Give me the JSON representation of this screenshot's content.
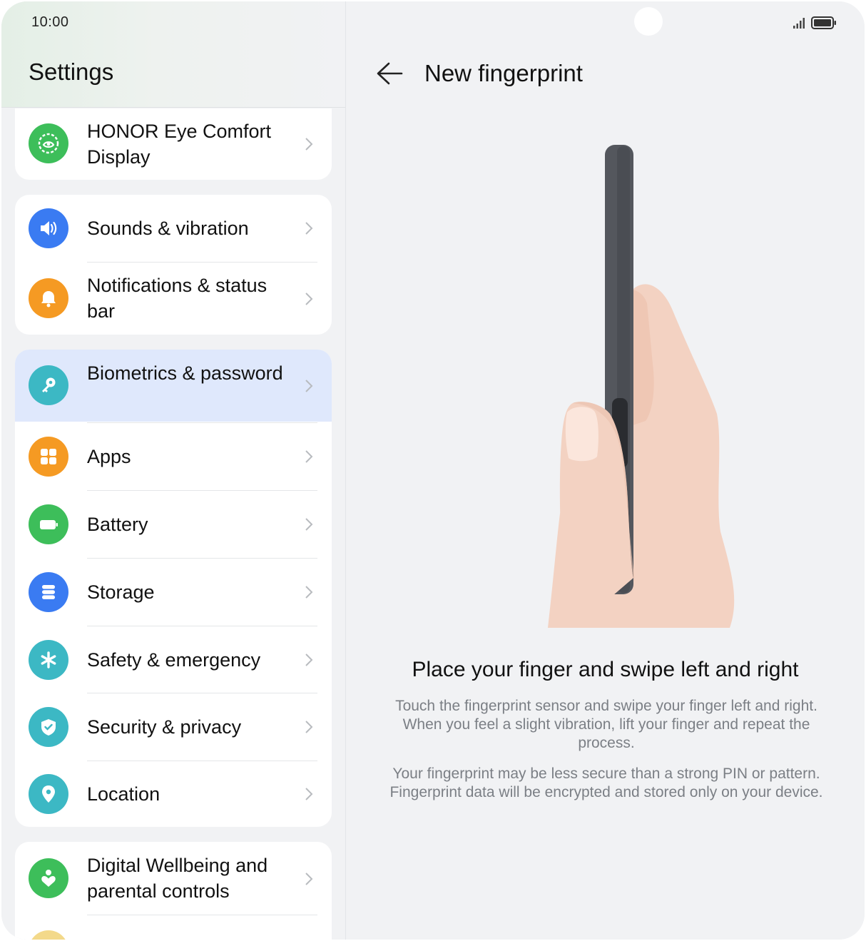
{
  "status_bar": {
    "time": "10:00"
  },
  "left_pane": {
    "title": "Settings",
    "items": [
      {
        "label": "HONOR Eye Comfort Display",
        "icon": "eye-comfort-icon",
        "color": "#3dbe5a"
      },
      {
        "label": "Sounds & vibration",
        "icon": "speaker-icon",
        "color": "#3a7bf2"
      },
      {
        "label": "Notifications & status bar",
        "icon": "bell-icon",
        "color": "#f59a23"
      },
      {
        "label": "Biometrics & password",
        "icon": "key-icon",
        "color": "#3cb8c4",
        "selected": true
      },
      {
        "label": "Apps",
        "icon": "apps-grid-icon",
        "color": "#f59a23"
      },
      {
        "label": "Battery",
        "icon": "battery-icon",
        "color": "#3dbe5a"
      },
      {
        "label": "Storage",
        "icon": "storage-icon",
        "color": "#3a7bf2"
      },
      {
        "label": "Safety & emergency",
        "icon": "asterisk-icon",
        "color": "#3cb8c4"
      },
      {
        "label": "Security & privacy",
        "icon": "shield-icon",
        "color": "#3cb8c4"
      },
      {
        "label": "Location",
        "icon": "location-pin-icon",
        "color": "#3cb8c4"
      },
      {
        "label": "Digital Wellbeing and parental controls",
        "icon": "heart-person-icon",
        "color": "#3dbe5a"
      }
    ],
    "selection_color": "#dfe8fc"
  },
  "right_pane": {
    "title": "New fingerprint",
    "headline": "Place your finger and swipe left and right",
    "description_1": "Touch the fingerprint sensor and swipe your finger left and right. When you feel a slight vibration, lift your finger and repeat the process.",
    "description_2": "Your fingerprint may be less secure than a strong PIN or pattern. Fingerprint data will be encrypted and stored only on your device."
  }
}
